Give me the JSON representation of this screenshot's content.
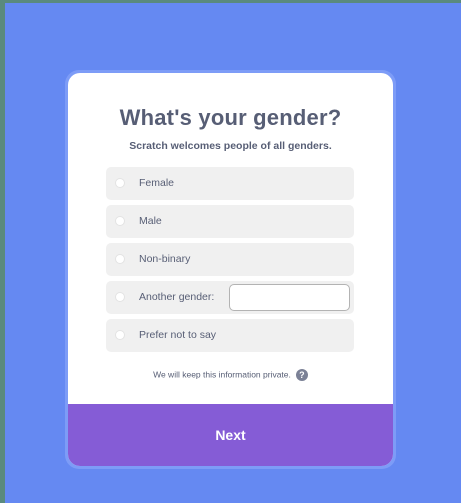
{
  "modal": {
    "title": "What's your gender?",
    "subtitle": "Scratch welcomes people of all genders.",
    "options": [
      {
        "label": "Female"
      },
      {
        "label": "Male"
      },
      {
        "label": "Non-binary"
      },
      {
        "label": "Another gender:"
      },
      {
        "label": "Prefer not to say"
      }
    ],
    "another_gender_input": {
      "value": "",
      "placeholder": ""
    },
    "privacy_text": "We will keep this information private.",
    "help_icon": "question-mark-icon",
    "next_label": "Next"
  },
  "colors": {
    "background": "#6589f2",
    "accent": "#855cd6",
    "text": "#575e75",
    "option_bg": "#f0f0f0"
  }
}
